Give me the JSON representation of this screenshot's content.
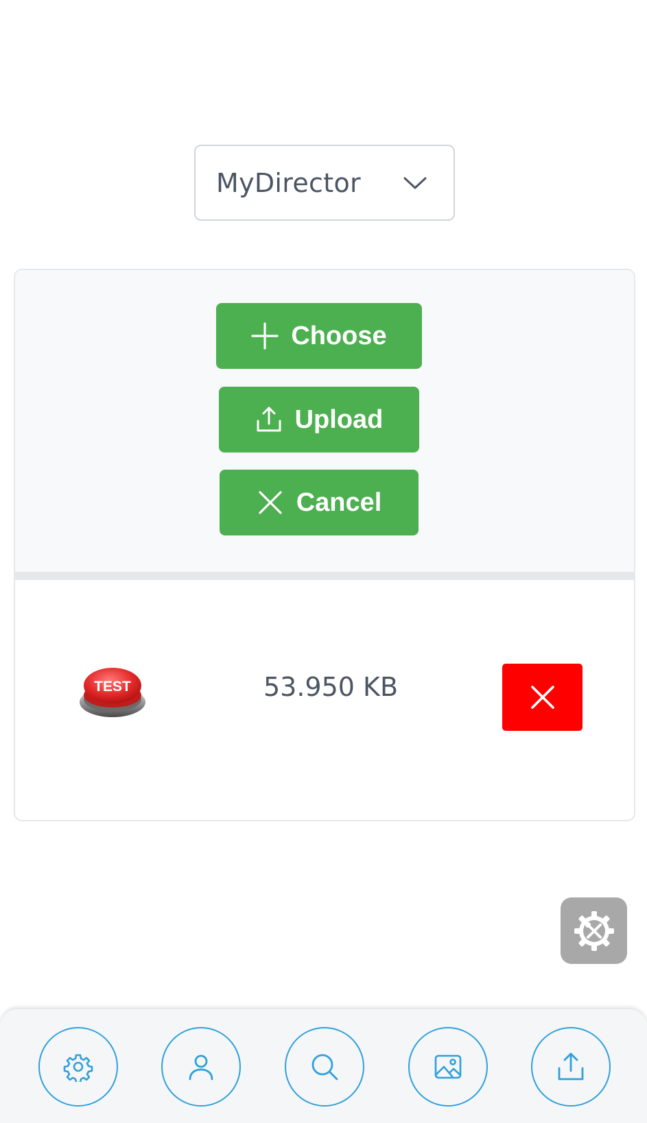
{
  "directory_select": {
    "value": "MyDirector",
    "icon": "chevron-down-icon"
  },
  "upload_toolbar": {
    "choose_label": "Choose",
    "choose_icon": "plus-icon",
    "upload_label": "Upload",
    "upload_icon": "upload-icon",
    "cancel_label": "Cancel",
    "cancel_icon": "close-icon"
  },
  "files": [
    {
      "thumbnail": "test-button-image",
      "thumbnail_text": "TEST",
      "size": "53.950 KB",
      "remove_icon": "close-icon"
    }
  ],
  "floating_button": {
    "icon": "settings-tools-icon"
  },
  "bottom_nav": [
    {
      "icon": "gear-icon"
    },
    {
      "icon": "user-icon"
    },
    {
      "icon": "search-icon"
    },
    {
      "icon": "image-icon"
    },
    {
      "icon": "upload-icon"
    }
  ],
  "colors": {
    "button_green": "#4caf50",
    "remove_red": "#ff0000",
    "nav_accent": "#2ea0dc",
    "fab_gray": "#a8a8a8"
  }
}
